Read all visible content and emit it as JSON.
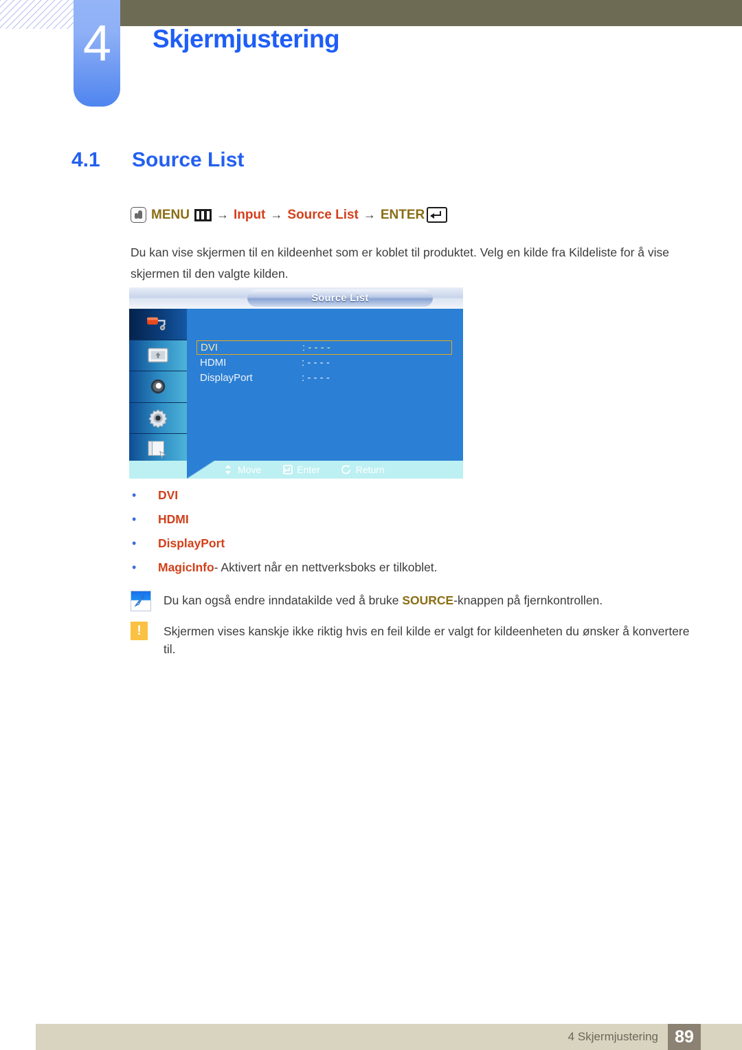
{
  "header": {
    "chapter_number": "4",
    "chapter_title": "Skjermjustering",
    "olive_bar_color": "#6e6b55",
    "tab_color": "#4f85ef",
    "title_color": "#1f5ef5"
  },
  "section": {
    "number": "4.1",
    "title": "Source List",
    "color": "#2460f0"
  },
  "menu_path": {
    "press_icon": "hand-press-icon",
    "menu_label": "MENU",
    "menu_icon": "menu-bars-icon",
    "arrow1": "→",
    "item1": "Input",
    "arrow2": "→",
    "item2": "Source List",
    "arrow3": "→",
    "enter_label": "ENTER",
    "enter_icon": "enter-key-icon",
    "olive_color": "#8a6d15",
    "red_color": "#d4401b"
  },
  "body": {
    "paragraph": "Du kan vise skjermen til en kildeenhet som er koblet til produktet. Velg en kilde fra Kildeliste for å vise skjermen til den valgte kilden."
  },
  "osd": {
    "title": "Source List",
    "sidebar_icons": [
      "paint-roller-icon",
      "screen-display-icon",
      "speaker-icon",
      "gear-setup-icon",
      "multi-control-icon"
    ],
    "active_sidebar_index": 0,
    "rows": [
      {
        "label": "DVI",
        "value": ": - - - -",
        "selected": true
      },
      {
        "label": "HDMI",
        "value": ": - - - -",
        "selected": false
      },
      {
        "label": "DisplayPort",
        "value": ": - - - -",
        "selected": false
      }
    ],
    "footer": [
      {
        "icon": "up-down-arrow-icon",
        "label": "Move"
      },
      {
        "icon": "enter-key-icon",
        "label": "Enter"
      },
      {
        "icon": "return-arrow-icon",
        "label": "Return"
      }
    ],
    "background_color": "#2b7fd4",
    "highlight_border_color": "#e8a81e",
    "footer_bar_color": "#bdf0f2"
  },
  "bullets": [
    {
      "key": "DVI",
      "rest": ""
    },
    {
      "key": "HDMI",
      "rest": ""
    },
    {
      "key": "DisplayPort",
      "rest": ""
    },
    {
      "key": "MagicInfo",
      "rest": " - Aktivert når en nettverksboks er tilkoblet."
    }
  ],
  "notes": {
    "note": {
      "icon": "note-pen-icon",
      "text_before": "Du kan også endre inndatakilde ved å bruke ",
      "strong": "SOURCE",
      "text_after": "-knappen på fjernkontrollen."
    },
    "warning": {
      "icon": "warning-exclamation-icon",
      "glyph": "!",
      "text": "Skjermen vises kanskje ikke riktig hvis en feil kilde er valgt for kildeenheten du ønsker å konvertere til."
    }
  },
  "footer": {
    "label": "4 Skjermjustering",
    "page_number": "89",
    "bar_color": "#d9d4c0",
    "page_box_color": "#8c8273"
  }
}
